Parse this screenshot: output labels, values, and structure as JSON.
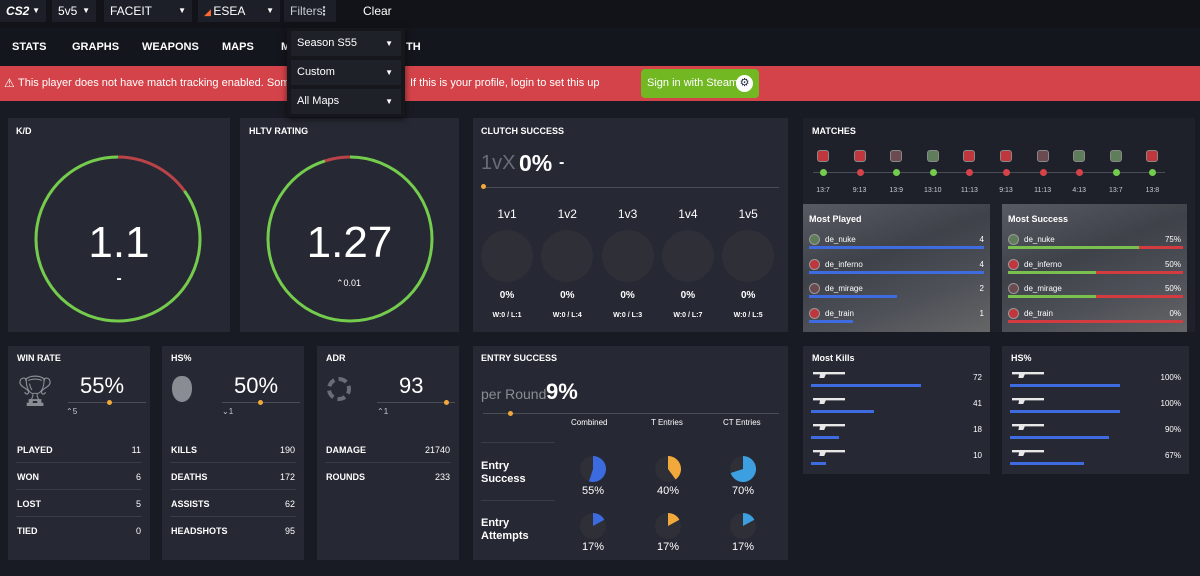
{
  "topbar": {
    "game": "CS2",
    "mode": "5v5",
    "platform": "FACEIT",
    "league": "ESEA",
    "filters": "Filters",
    "clear": "Clear"
  },
  "nav": {
    "items": [
      "STATS",
      "GRAPHS",
      "WEAPONS",
      "MAPS",
      "M",
      "TH"
    ]
  },
  "dropdown": {
    "items": [
      "Season S55",
      "Custom",
      "All Maps"
    ]
  },
  "banner": {
    "text1": "This player does not have match tracking enabled. Some",
    "text2": "If this is your profile, login to set this up",
    "signin": "Sign in with Steam"
  },
  "kd": {
    "title": "K/D",
    "value": "1.1",
    "delta": "-",
    "ratio": 0.85
  },
  "hltv": {
    "title": "HLTV RATING",
    "value": "1.27",
    "delta": "0.01",
    "ratio": 0.95
  },
  "clutch": {
    "title": "CLUTCH SUCCESS",
    "prefix": "1vX",
    "value": "0%",
    "delta": "-",
    "cols": [
      {
        "label": "1v1",
        "pct": "0%",
        "wl": "W:0 / L:1"
      },
      {
        "label": "1v2",
        "pct": "0%",
        "wl": "W:0 / L:4"
      },
      {
        "label": "1v3",
        "pct": "0%",
        "wl": "W:0 / L:3"
      },
      {
        "label": "1v4",
        "pct": "0%",
        "wl": "W:0 / L:7"
      },
      {
        "label": "1v5",
        "pct": "0%",
        "wl": "W:0 / L:5"
      }
    ]
  },
  "matches": {
    "title": "MATCHES",
    "list": [
      {
        "score": "13:7",
        "win": true,
        "color": "#c0363d"
      },
      {
        "score": "9:13",
        "win": false,
        "color": "#c0363d"
      },
      {
        "score": "13:9",
        "win": true,
        "color": "#6b4a50"
      },
      {
        "score": "13:10",
        "win": true,
        "color": "#5f7d5a"
      },
      {
        "score": "11:13",
        "win": false,
        "color": "#c0363d"
      },
      {
        "score": "9:13",
        "win": false,
        "color": "#c0363d"
      },
      {
        "score": "11:13",
        "win": false,
        "color": "#6b4a50"
      },
      {
        "score": "4:13",
        "win": false,
        "color": "#5f7d5a"
      },
      {
        "score": "13:7",
        "win": true,
        "color": "#5f7d5a"
      },
      {
        "score": "13:8",
        "win": true,
        "color": "#c0363d"
      }
    ]
  },
  "most_played": {
    "title": "Most Played",
    "rows": [
      {
        "map": "de_nuke",
        "val": "4",
        "frac": 1.0,
        "color": "#5f7d5a"
      },
      {
        "map": "de_inferno",
        "val": "4",
        "frac": 1.0,
        "color": "#c0363d"
      },
      {
        "map": "de_mirage",
        "val": "2",
        "frac": 0.5,
        "color": "#6b4a50"
      },
      {
        "map": "de_train",
        "val": "1",
        "frac": 0.25,
        "color": "#c0363d"
      }
    ]
  },
  "most_success": {
    "title": "Most Success",
    "rows": [
      {
        "map": "de_nuke",
        "val": "75%",
        "frac": 0.75,
        "color": "#5f7d5a"
      },
      {
        "map": "de_inferno",
        "val": "50%",
        "frac": 0.5,
        "color": "#c0363d"
      },
      {
        "map": "de_mirage",
        "val": "50%",
        "frac": 0.5,
        "color": "#6b4a50"
      },
      {
        "map": "de_train",
        "val": "0%",
        "frac": 0.0,
        "color": "#c0363d"
      }
    ]
  },
  "winrate": {
    "title": "WIN RATE",
    "value": "55%",
    "sub": "5",
    "rows": [
      [
        "PLAYED",
        "11"
      ],
      [
        "WON",
        "6"
      ],
      [
        "LOST",
        "5"
      ],
      [
        "TIED",
        "0"
      ]
    ]
  },
  "hs": {
    "title": "HS%",
    "value": "50%",
    "sub": "1",
    "rows": [
      [
        "KILLS",
        "190"
      ],
      [
        "DEATHS",
        "172"
      ],
      [
        "ASSISTS",
        "62"
      ],
      [
        "HEADSHOTS",
        "95"
      ]
    ]
  },
  "adr": {
    "title": "ADR",
    "value": "93",
    "sub": "1",
    "rows": [
      [
        "DAMAGE",
        "21740"
      ],
      [
        "ROUNDS",
        "233"
      ]
    ]
  },
  "entry": {
    "title": "ENTRY SUCCESS",
    "prefix": "per Round",
    "value": "9%",
    "headers": [
      "Combined",
      "T Entries",
      "CT Entries"
    ],
    "success_label": [
      "Entry",
      "Success"
    ],
    "attempts_label": [
      "Entry",
      "Attempts"
    ],
    "success": [
      {
        "pct": "55%",
        "frac": 0.55,
        "color": "#3b6bdf"
      },
      {
        "pct": "40%",
        "frac": 0.4,
        "color": "#f2a93b"
      },
      {
        "pct": "70%",
        "frac": 0.7,
        "color": "#3b9fe0"
      }
    ],
    "attempts": [
      {
        "pct": "17%",
        "frac": 0.17,
        "color": "#3b6bdf"
      },
      {
        "pct": "17%",
        "frac": 0.17,
        "color": "#f2a93b"
      },
      {
        "pct": "17%",
        "frac": 0.17,
        "color": "#3b9fe0"
      }
    ]
  },
  "most_kills": {
    "title": "Most Kills",
    "rows": [
      {
        "val": "72",
        "frac": 1.0
      },
      {
        "val": "41",
        "frac": 0.57
      },
      {
        "val": "18",
        "frac": 0.25
      },
      {
        "val": "10",
        "frac": 0.14
      }
    ]
  },
  "hs_weapons": {
    "title": "HS%",
    "rows": [
      {
        "val": "100%",
        "frac": 1.0
      },
      {
        "val": "100%",
        "frac": 1.0
      },
      {
        "val": "90%",
        "frac": 0.9
      },
      {
        "val": "67%",
        "frac": 0.67
      }
    ]
  }
}
